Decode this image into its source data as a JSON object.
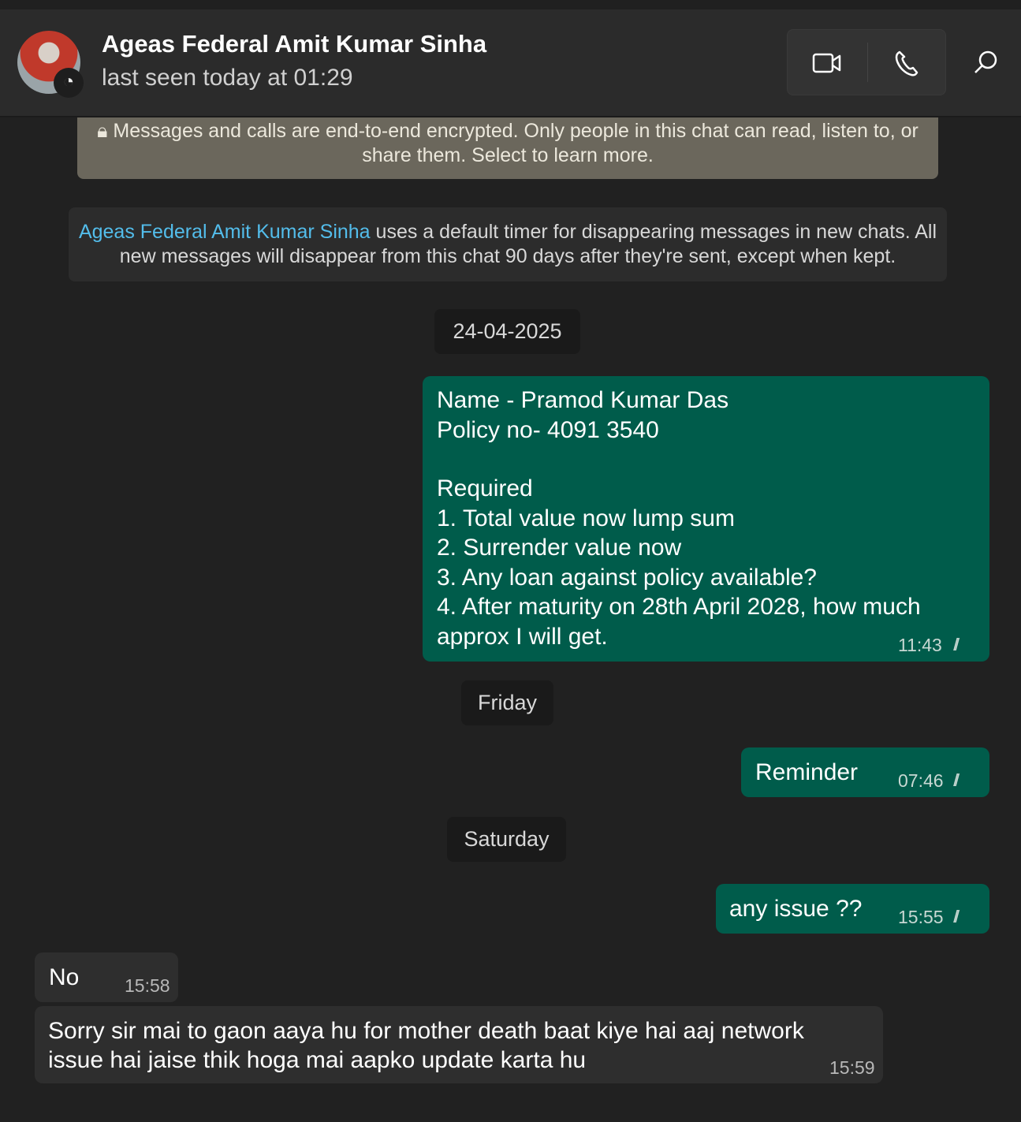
{
  "header": {
    "name": "Ageas Federal Amit Kumar Sinha",
    "status": "last seen today at 01:29"
  },
  "banner": {
    "encryption": "Messages and calls are end-to-end encrypted. Only people in this chat can read, listen to, or share them. Select to learn more.",
    "disappearing_name": "Ageas Federal Amit Kumar Sinha",
    "disappearing_text": " uses a default timer for disappearing messages in new chats. All new messages will disappear from this chat 90 days after they're sent, except when kept."
  },
  "dates": [
    "24-04-2025",
    "Friday",
    "Saturday"
  ],
  "messages": [
    {
      "dir": "out",
      "lines": [
        "Name - Pramod Kumar Das",
        "Policy no- 4091 3540",
        "",
        "Required",
        "1. Total value now lump sum",
        "2. Surrender value now",
        "3. Any loan against policy available?",
        "4. After maturity on 28th April 2028, how much",
        "approx I will get."
      ],
      "time": "11:43"
    },
    {
      "dir": "out",
      "text": "Reminder",
      "time": "07:46"
    },
    {
      "dir": "out",
      "text": "any issue ??",
      "time": "15:55"
    },
    {
      "dir": "in",
      "text": "No",
      "time": "15:58"
    },
    {
      "dir": "in",
      "lines": [
        "Sorry sir mai to gaon aaya hu for mother death baat kiye hai aaj network",
        "issue hai jaise thik hoga mai aapko update karta hu"
      ],
      "time": "15:59"
    }
  ],
  "colors": {
    "outgoing": "#005c4b",
    "incoming": "#2e2e2e",
    "link": "#53bdeb"
  }
}
